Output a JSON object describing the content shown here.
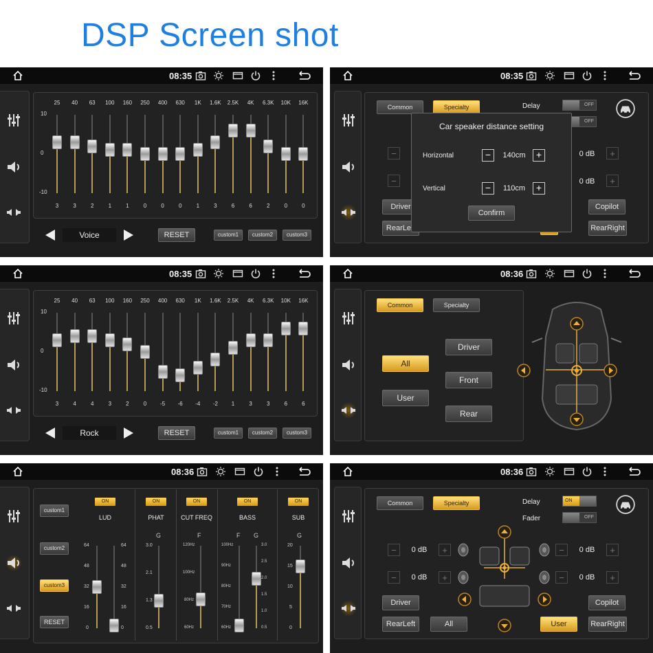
{
  "title": "DSP Screen shot",
  "status_times": [
    "08:35",
    "08:35",
    "08:35",
    "08:36",
    "08:36",
    "08:36"
  ],
  "eq": {
    "freqs": [
      "25",
      "40",
      "63",
      "100",
      "160",
      "250",
      "400",
      "630",
      "1K",
      "1.6K",
      "2.5K",
      "4K",
      "6.3K",
      "10K",
      "16K"
    ],
    "axis_top": "10",
    "axis_mid": "0",
    "axis_bot": "-10",
    "reset": "RESET",
    "custom": [
      "custom1",
      "custom2",
      "custom3"
    ],
    "voice": {
      "preset": "Voice",
      "values_text": [
        "3",
        "3",
        "2",
        "1",
        "1",
        "0",
        "0",
        "0",
        "1",
        "3",
        "6",
        "6",
        "2",
        "0",
        "0"
      ],
      "values": [
        3,
        3,
        2,
        1,
        1,
        0,
        0,
        0,
        1,
        3,
        6,
        6,
        2,
        0,
        0
      ]
    },
    "rock": {
      "preset": "Rock",
      "values_text": [
        "3",
        "4",
        "4",
        "3",
        "2",
        "0",
        "-5",
        "-6",
        "-4",
        "-2",
        "1",
        "3",
        "3",
        "6",
        "6"
      ],
      "values": [
        3,
        4,
        4,
        3,
        2,
        0,
        -5,
        -6,
        -4,
        -2,
        1,
        3,
        3,
        6,
        6
      ]
    }
  },
  "specialty_dialog": {
    "tab_common": "Common",
    "tab_specialty": "Specialty",
    "delay_label": "Delay",
    "off": "OFF",
    "dialog_title": "Car speaker distance setting",
    "horizontal_label": "Horizontal",
    "horizontal_value": "140cm",
    "vertical_label": "Vertical",
    "vertical_value": "110cm",
    "confirm": "Confirm",
    "db_right_top": "0 dB",
    "db_right_bottom": "0 dB",
    "driver": "Driver",
    "copilot": "Copilot",
    "rearleft": "RearLeft",
    "rearright": "RearRight",
    "minus": "−",
    "plus": "+"
  },
  "common_screen": {
    "tab_common": "Common",
    "tab_specialty": "Specialty",
    "all": "All",
    "user": "User",
    "driver": "Driver",
    "front": "Front",
    "rear": "Rear"
  },
  "bass_screen": {
    "custom": [
      "custom1",
      "custom2",
      "custom3"
    ],
    "reset": "RESET",
    "on": "ON",
    "columns": [
      "LUD",
      "PHAT",
      "CUT FREQ",
      "BASS",
      "SUB"
    ],
    "sub_g": "G",
    "sub_f": "F",
    "lud_scale": [
      "64",
      "48",
      "32",
      "16",
      "0"
    ],
    "phat_scale": [
      "3.0",
      "2.1",
      "1.3",
      "0.5"
    ],
    "cut_scale": [
      "120Hz",
      "100Hz",
      "80Hz",
      "60Hz"
    ],
    "bass_f_scale": [
      "100Hz",
      "90Hz",
      "80Hz",
      "70Hz",
      "60Hz"
    ],
    "bass_g_scale": [
      "3.0",
      "2.5",
      "2.0",
      "1.5",
      "1.0",
      "0.5"
    ],
    "sub_scale": [
      "20",
      "15",
      "10",
      "5",
      "0"
    ]
  },
  "specialty_full": {
    "tab_common": "Common",
    "tab_specialty": "Specialty",
    "delay_label": "Delay",
    "fader_label": "Fader",
    "on": "ON",
    "off": "OFF",
    "db": [
      "0 dB",
      "0 dB",
      "0 dB",
      "0 dB"
    ],
    "driver": "Driver",
    "copilot": "Copilot",
    "rearleft": "RearLeft",
    "all": "All",
    "user": "User",
    "rearright": "RearRight",
    "minus": "−",
    "plus": "+"
  }
}
